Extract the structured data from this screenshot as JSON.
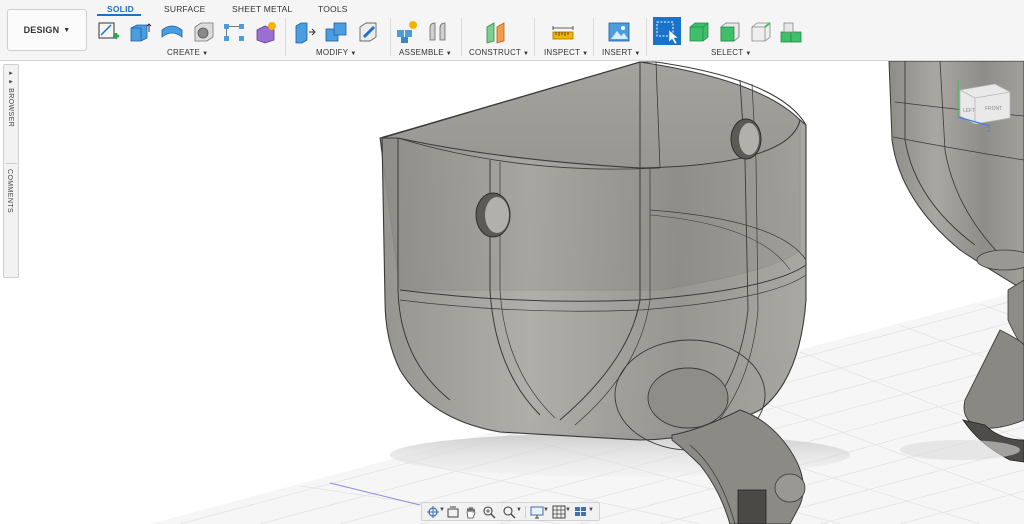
{
  "toolbar": {
    "workspace_label": "DESIGN",
    "tabs": [
      {
        "label": "SOLID",
        "active": true
      },
      {
        "label": "SURFACE",
        "active": false
      },
      {
        "label": "SHEET METAL",
        "active": false
      },
      {
        "label": "TOOLS",
        "active": false
      }
    ],
    "groups": [
      {
        "label": "CREATE",
        "tools": [
          "create-sketch-icon",
          "extrude-icon",
          "revolve-icon",
          "hole-icon",
          "pattern-icon",
          "form-icon"
        ]
      },
      {
        "label": "MODIFY",
        "tools": [
          "press-pull-icon",
          "combine-icon",
          "shell-icon"
        ]
      },
      {
        "label": "ASSEMBLE",
        "tools": [
          "new-component-icon",
          "joint-icon"
        ]
      },
      {
        "label": "CONSTRUCT",
        "tools": [
          "offset-plane-icon"
        ]
      },
      {
        "label": "INSPECT",
        "tools": [
          "measure-icon"
        ]
      },
      {
        "label": "INSERT",
        "tools": [
          "insert-image-icon"
        ]
      },
      {
        "label": "SELECT",
        "tools": [
          "window-select-icon",
          "select-body-icon",
          "select-face-icon",
          "select-edge-icon",
          "select-component-icon"
        ]
      }
    ],
    "accent_color": "#1a73c9"
  },
  "browser_panel": {
    "browser_label": "BROWSER",
    "comments_label": "COMMENTS"
  },
  "viewcube": {
    "left_label": "LEFT",
    "front_label": "FRONT",
    "axis_z": "Z"
  },
  "navbar": {
    "tools": [
      "orbit-icon",
      "look-at-icon",
      "pan-icon",
      "zoom-icon",
      "fit-icon",
      "display-settings-icon",
      "grid-settings-icon",
      "viewports-icon"
    ]
  }
}
